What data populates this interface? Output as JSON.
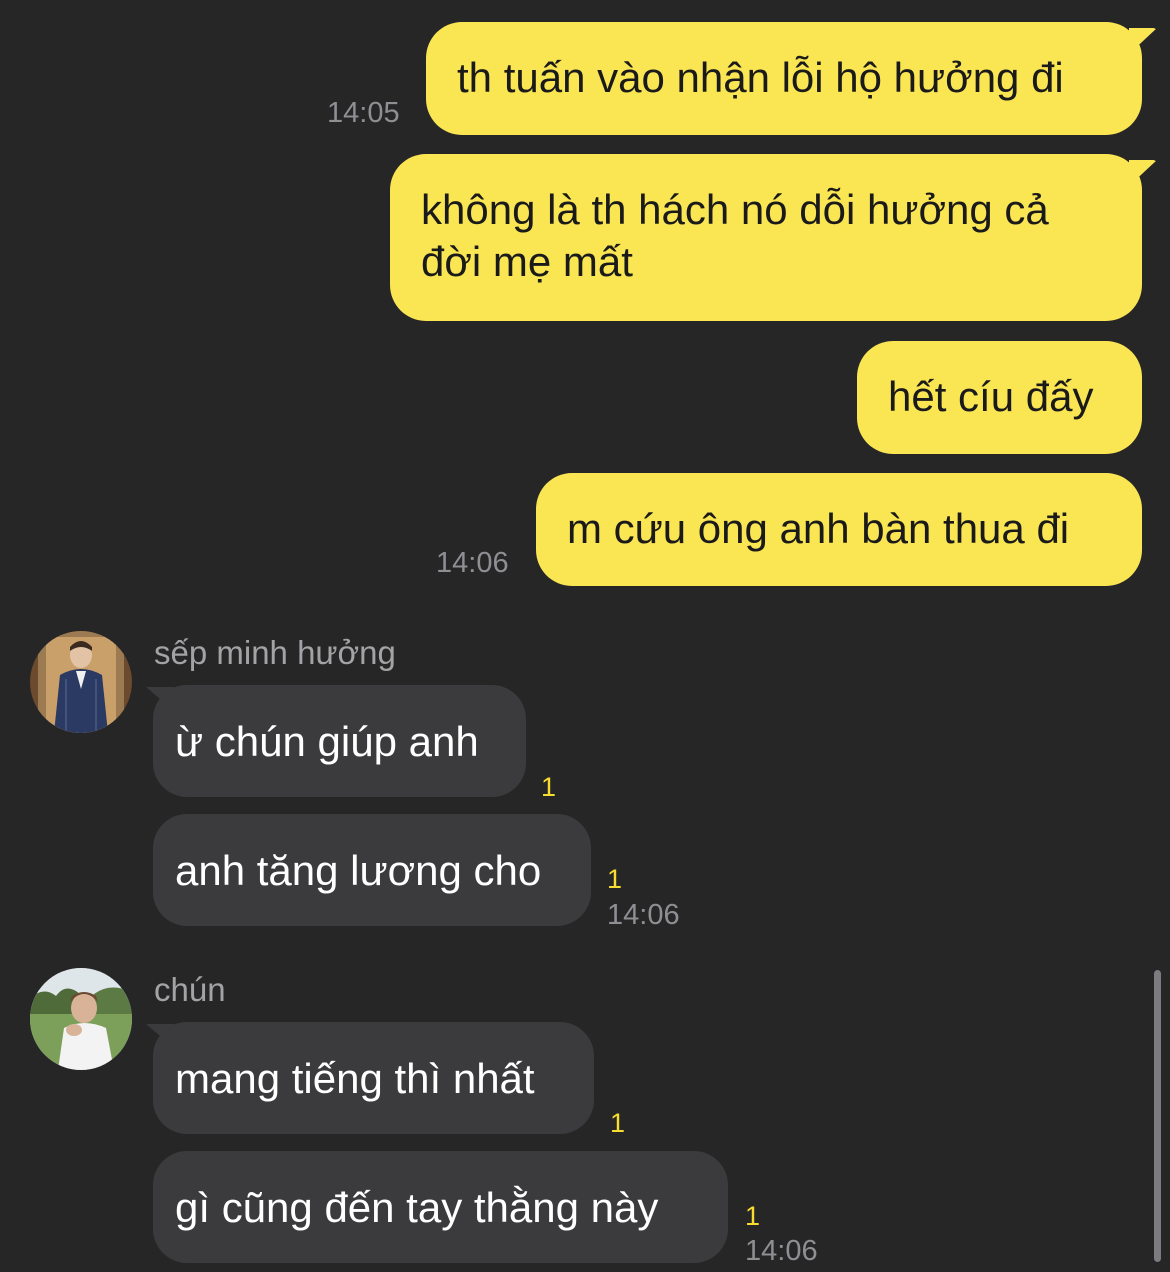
{
  "outgoing": [
    {
      "text": "th tuấn vào nhận lỗi hộ hưởng đi",
      "time": "14:05"
    },
    {
      "text": "không là th hách nó dỗi hưởng cả\nđời mẹ mất",
      "time": ""
    },
    {
      "text": "hết cíu đấy",
      "time": ""
    },
    {
      "text": "m cứu ông anh bàn thua đi",
      "time": "14:06"
    }
  ],
  "groups": [
    {
      "sender": "sếp minh hưởng",
      "avatar_icon": "profile-photo-man-in-suit",
      "messages": [
        {
          "text": "ừ chún giúp anh",
          "unread": "1",
          "time": ""
        },
        {
          "text": "anh tăng lương cho",
          "unread": "1",
          "time": "14:06"
        }
      ]
    },
    {
      "sender": "chún",
      "avatar_icon": "profile-photo-outdoors",
      "messages": [
        {
          "text": "mang tiếng thì nhất",
          "unread": "1",
          "time": ""
        },
        {
          "text": "gì cũng đến tay thằng này",
          "unread": "1",
          "time": "14:06"
        }
      ]
    }
  ],
  "colors": {
    "background": "#262627",
    "outgoing_bubble": "#fae553",
    "incoming_bubble": "#3b3b3d",
    "unread_count": "#f7dd2f"
  }
}
